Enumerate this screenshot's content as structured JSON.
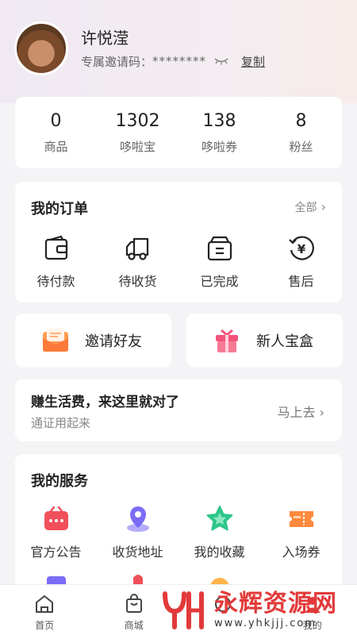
{
  "profile": {
    "name": "许悦滢",
    "invite_label": "专属邀请码：",
    "invite_code": "********",
    "copy_label": "复制"
  },
  "stats": [
    {
      "value": "0",
      "label": "商品"
    },
    {
      "value": "1302",
      "label": "哆啦宝"
    },
    {
      "value": "138",
      "label": "哆啦券"
    },
    {
      "value": "8",
      "label": "粉丝"
    }
  ],
  "orders": {
    "title": "我的订单",
    "all_label": "全部",
    "items": [
      {
        "label": "待付款",
        "icon": "wallet-icon"
      },
      {
        "label": "待收货",
        "icon": "truck-icon"
      },
      {
        "label": "已完成",
        "icon": "box-icon"
      },
      {
        "label": "售后",
        "icon": "yen-refund-icon"
      }
    ]
  },
  "shortcuts": {
    "invite_label": "邀请好友",
    "gift_label": "新人宝盒"
  },
  "promo": {
    "title": "赚生活费，来这里就对了",
    "subtitle": "通证用起来",
    "action": "马上去"
  },
  "services": {
    "title": "我的服务",
    "items": [
      {
        "label": "官方公告",
        "icon": "announcement-icon"
      },
      {
        "label": "收货地址",
        "icon": "location-pin-icon"
      },
      {
        "label": "我的收藏",
        "icon": "star-icon"
      },
      {
        "label": "入场券",
        "icon": "ticket-icon"
      }
    ]
  },
  "tabbar": [
    {
      "label": "首页",
      "icon": "home-icon"
    },
    {
      "label": "商城",
      "icon": "shopping-bag-icon"
    },
    {
      "label": "",
      "icon": "tab-icon"
    },
    {
      "label": "我的",
      "icon": "profile-icon"
    }
  ],
  "watermark": {
    "title": "永辉资源网",
    "url": "www.yhkjjj.com"
  },
  "colors": {
    "accent_red": "#f0505a",
    "accent_orange": "#ff8a3d",
    "accent_purple": "#7b6cf6",
    "accent_green": "#2ec58a"
  }
}
